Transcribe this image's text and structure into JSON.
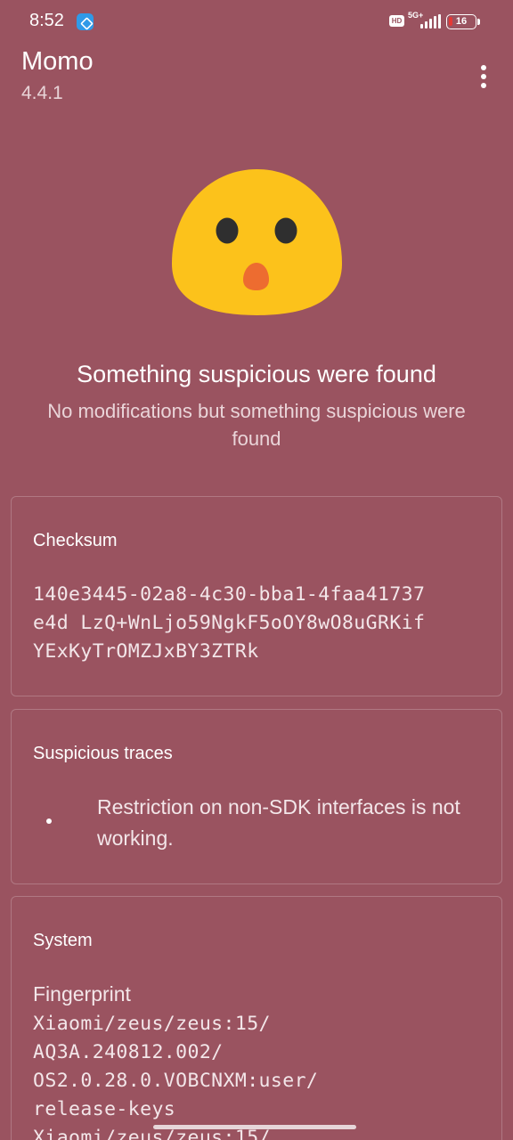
{
  "status_bar": {
    "time": "8:52",
    "hd_label": "HD",
    "network_label": "5G+",
    "battery_level": "16",
    "icons": [
      "app-notification-icon",
      "hd-icon",
      "signal-icon",
      "battery-icon"
    ]
  },
  "header": {
    "title": "Momo",
    "version": "4.4.1",
    "menu_icon": "more-vert-icon"
  },
  "result": {
    "icon": "surprised-face-icon",
    "title": "Something suspicious were found",
    "description": "No modifications but something suspicious were found"
  },
  "cards": {
    "checksum": {
      "title": "Checksum",
      "value": "140e3445-02a8-4c30-bba1-4faa41737\ne4d LzQ+WnLjo59NgkF5oOY8wO8uGRKif\nYExKyTrOMZJxBY3ZTRk"
    },
    "suspicious_traces": {
      "title": "Suspicious traces",
      "items": [
        "Restriction on non-SDK interfaces is not working."
      ]
    },
    "system": {
      "title": "System",
      "fingerprint_label": "Fingerprint",
      "fingerprint_value": "Xiaomi/zeus/zeus:15/\nAQ3A.240812.002/\nOS2.0.28.0.VOBCNXM:user/\nrelease-keys\nXiaomi/zeus/zeus:15/"
    }
  },
  "colors": {
    "background": "#9a5360",
    "face": "#fcc21b",
    "mouth": "#ed6c30",
    "eyes": "#2f2f2f"
  }
}
